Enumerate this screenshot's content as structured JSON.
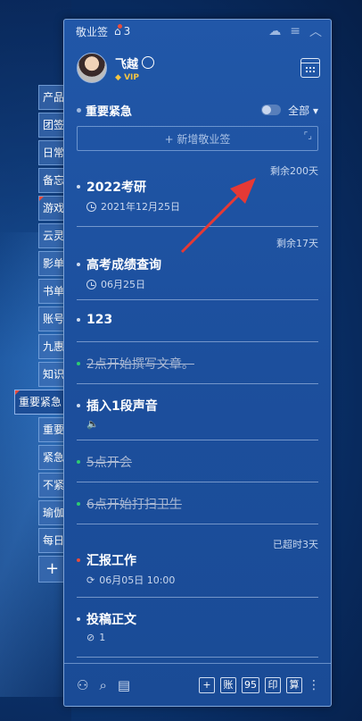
{
  "window": {
    "title": "敬业签",
    "notification_count": "3"
  },
  "user": {
    "name": "飞越",
    "badge": "VIP"
  },
  "category": {
    "name": "重要紧急",
    "filter": "全部"
  },
  "add_button": {
    "label": "+ 新增敬业签"
  },
  "side_tabs": [
    {
      "label": "产品"
    },
    {
      "label": "团签"
    },
    {
      "label": "日常"
    },
    {
      "label": "备忘"
    },
    {
      "label": "游戏"
    },
    {
      "label": "云灵"
    },
    {
      "label": "影单"
    },
    {
      "label": "书单"
    },
    {
      "label": "账号"
    },
    {
      "label": "九惠"
    },
    {
      "label": "知识"
    },
    {
      "label": "重要紧急"
    },
    {
      "label": "重要"
    },
    {
      "label": "紧急"
    },
    {
      "label": "不紧"
    },
    {
      "label": "瑜伽"
    },
    {
      "label": "每日"
    }
  ],
  "items": [
    {
      "remain": "剩余200天",
      "text": "2022考研",
      "meta": "2021年12月25日"
    },
    {
      "remain": "剩余17天",
      "text": "高考成绩查询",
      "meta": "06月25日"
    },
    {
      "text": "123"
    },
    {
      "text": "2点开始撰写文章。"
    },
    {
      "text": "插入1段声音",
      "meta_icon": "sound-icon"
    },
    {
      "text": "5点开会"
    },
    {
      "text": "6点开始打扫卫生"
    },
    {
      "remain": "已超时3天",
      "text": "汇报工作",
      "meta": "06月05日 10:00"
    },
    {
      "text": "投稿正文",
      "meta": "1"
    }
  ],
  "footer": {
    "buttons": [
      "+",
      "账",
      "95",
      "印",
      "算"
    ]
  },
  "colors": {
    "panel": "#1c4f9d",
    "done_dot": "#2ecc71",
    "urgent_dot": "#e74c3c",
    "arrow": "#e53935"
  }
}
